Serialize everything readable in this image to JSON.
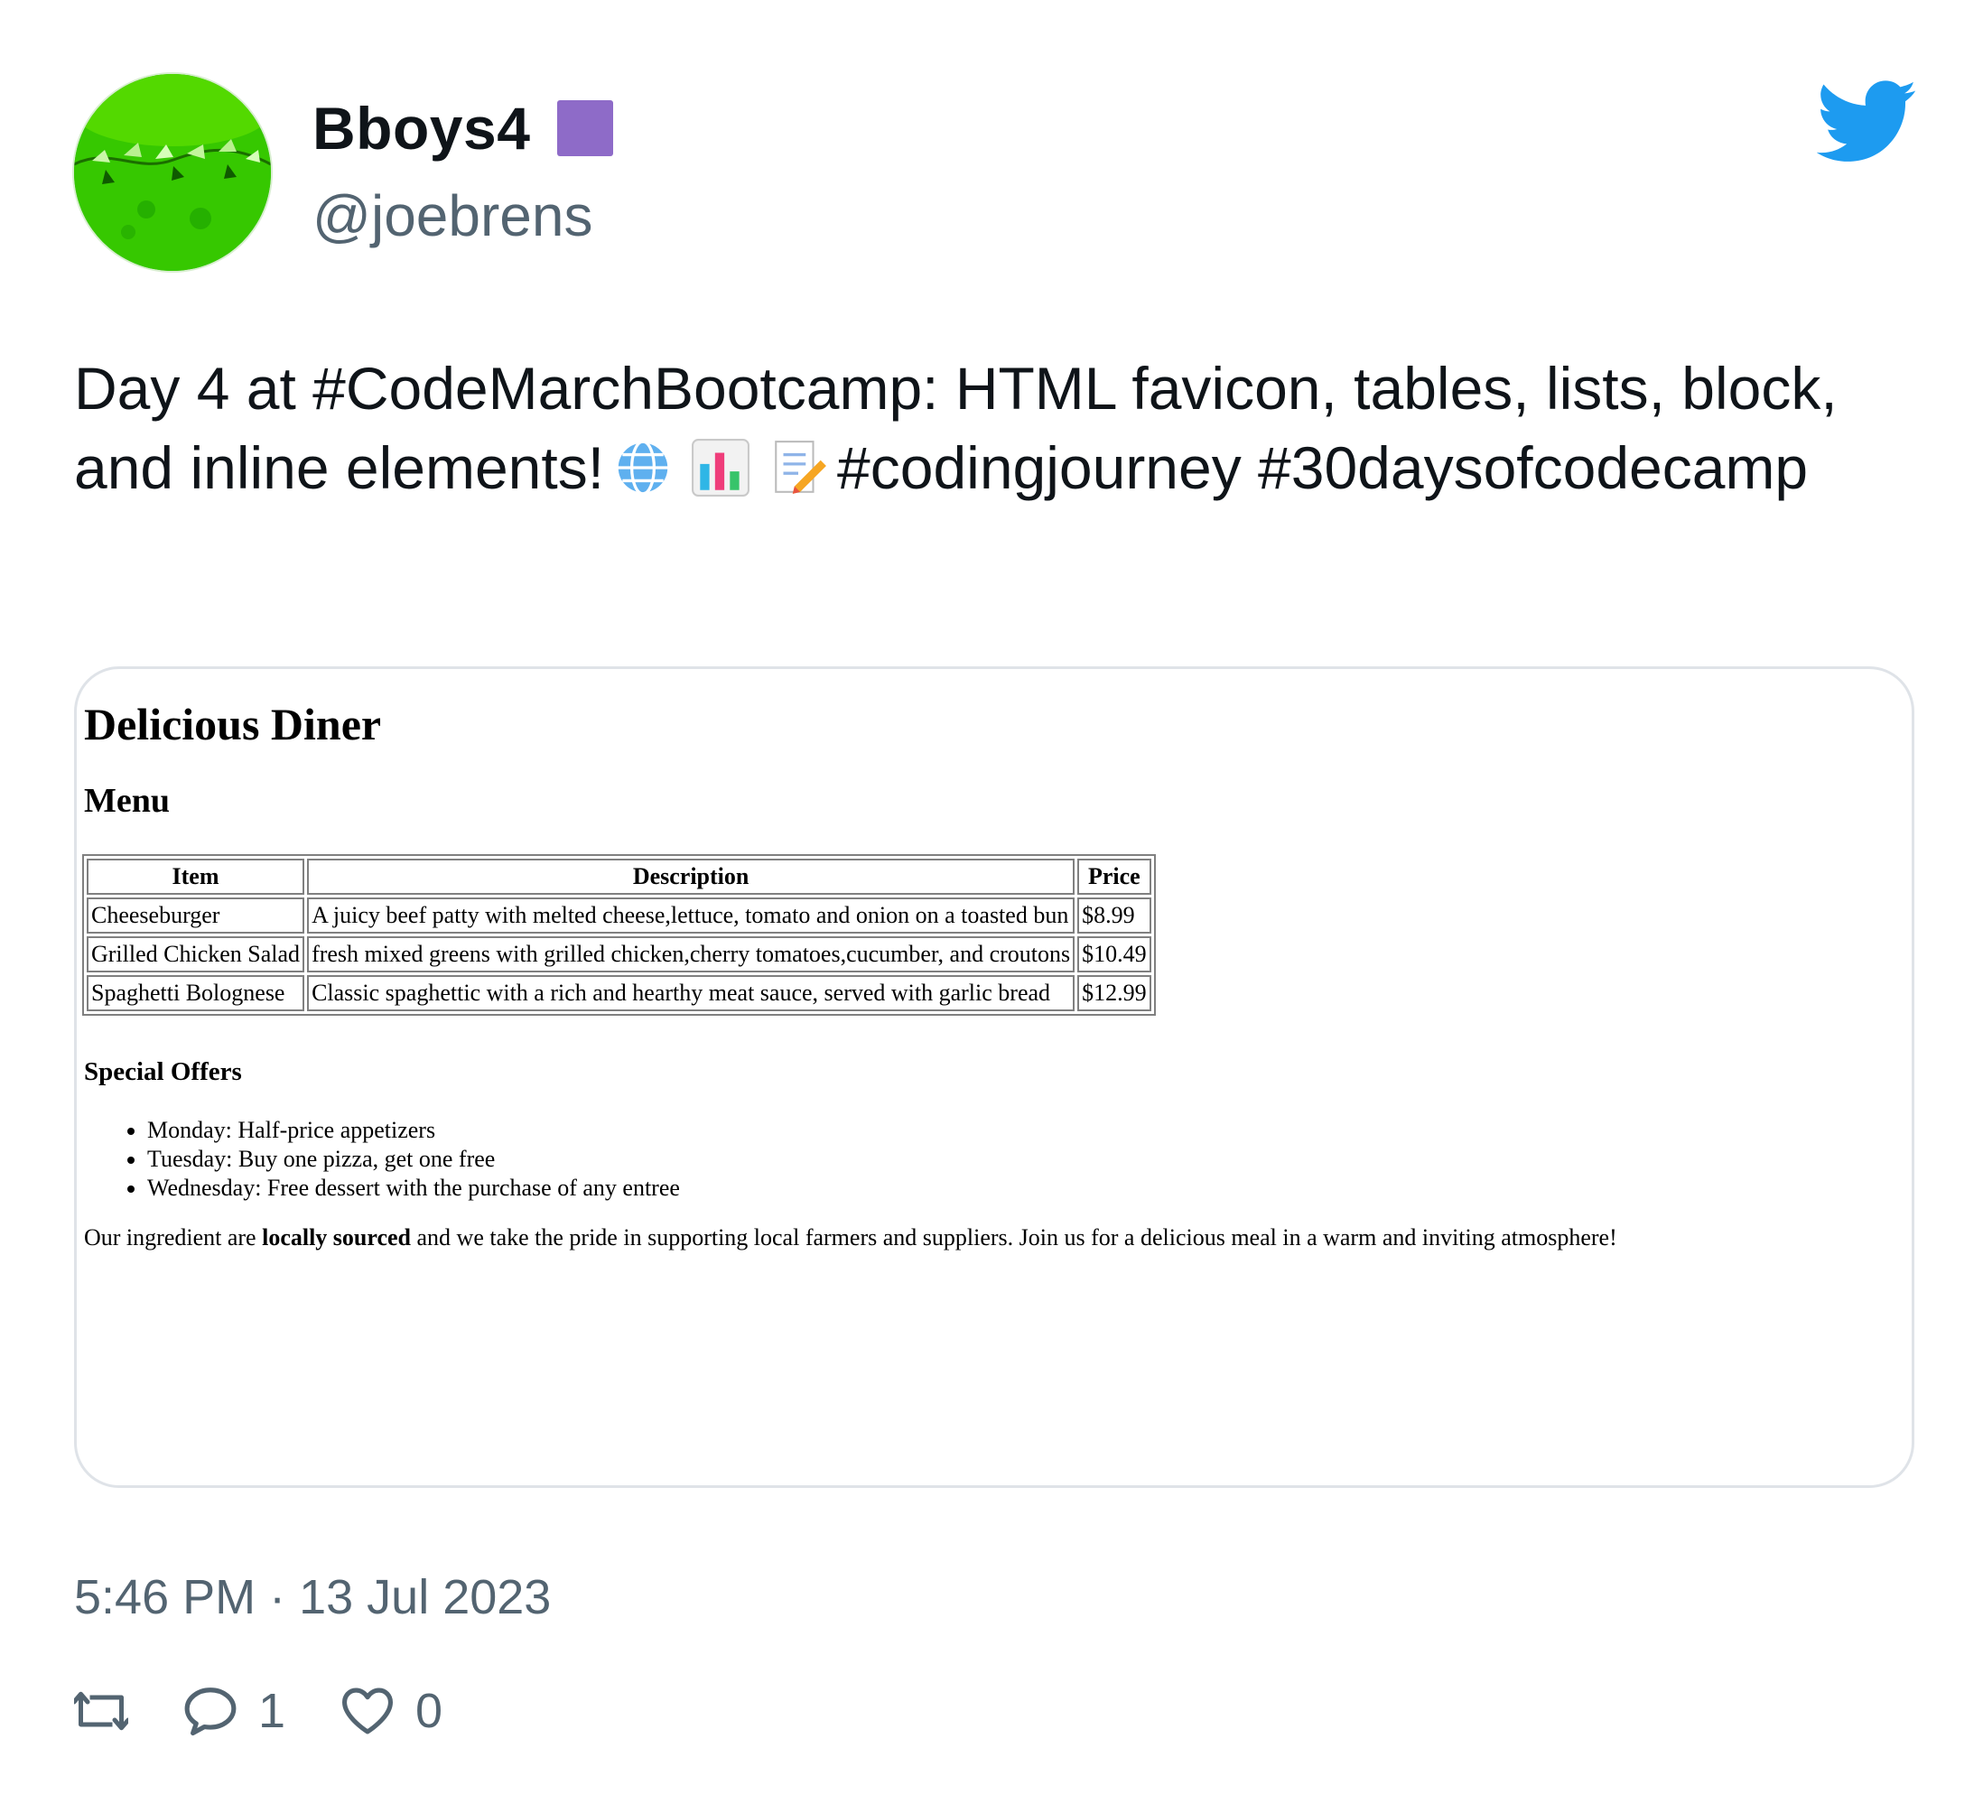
{
  "author": {
    "display_name": "Bboys4",
    "handle": "@joebrens",
    "badge_color": "#8e6bc8"
  },
  "platform_icon": "twitter-bird-icon",
  "tweet": {
    "text_part1": "Day 4 at #CodeMarchBootcamp: HTML favicon, tables, lists, block, and inline elements!",
    "emojis": [
      "globe-icon",
      "bar-chart-icon",
      "memo-icon"
    ],
    "text_part2": "#codingjourney #30daysofcodecamp"
  },
  "embedded_page": {
    "title": "Delicious Diner",
    "menu_heading": "Menu",
    "table": {
      "headers": [
        "Item",
        "Description",
        "Price"
      ],
      "rows": [
        [
          "Cheeseburger",
          "A juicy beef patty with melted cheese,lettuce, tomato and onion on a toasted bun",
          "$8.99"
        ],
        [
          "Grilled Chicken Salad",
          "fresh mixed greens with grilled chicken,cherry tomatoes,cucumber, and croutons",
          "$10.49"
        ],
        [
          "Spaghetti Bolognese",
          "Classic spaghettic with a rich and hearthy meat sauce, served with garlic bread",
          "$12.99"
        ]
      ]
    },
    "offers_heading": "Special Offers",
    "offers": [
      "Monday: Half-price appetizers",
      "Tuesday: Buy one pizza, get one free",
      "Wednesday: Free dessert with the purchase of any entree"
    ],
    "about_before": "Our ingredient are ",
    "about_bold": "locally sourced",
    "about_after": " and we take the pride in supporting local farmers and suppliers. Join us for a delicious meal in a warm and inviting atmosphere!"
  },
  "timestamp": "5:46 PM · 13 Jul 2023",
  "actions": {
    "retweet_icon": "retweet-icon",
    "reply_icon": "reply-icon",
    "reply_count": "1",
    "like_icon": "heart-icon",
    "like_count": "0"
  },
  "colors": {
    "text": "#0f1419",
    "secondary": "#536471",
    "twitter_blue": "#1d9bf0",
    "card_border": "#dfe3e8"
  }
}
